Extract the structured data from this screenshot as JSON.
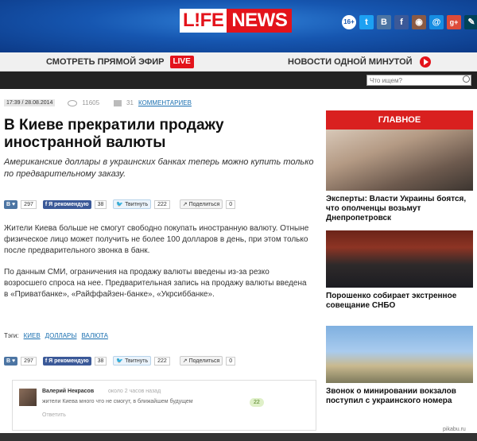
{
  "brand": {
    "life": "L!FE",
    "news": "NEWS",
    "age": "16+"
  },
  "social": [
    {
      "icon": "twitter-icon",
      "glyph": "t",
      "color": "#1da1f2"
    },
    {
      "icon": "vk-icon",
      "glyph": "В",
      "color": "#4c75a3"
    },
    {
      "icon": "facebook-icon",
      "glyph": "f",
      "color": "#3b5998"
    },
    {
      "icon": "instagram-icon",
      "glyph": "◉",
      "color": "#8a5a44"
    },
    {
      "icon": "mailru-icon",
      "glyph": "@",
      "color": "#168de2"
    },
    {
      "icon": "googleplus-icon",
      "glyph": "g+",
      "color": "#dd4b39"
    },
    {
      "icon": "livejournal-icon",
      "glyph": "✎",
      "color": "#004359"
    },
    {
      "icon": "odnoklassniki-icon",
      "glyph": "ok",
      "color": "#f2720c"
    }
  ],
  "nav": {
    "live_label": "СМОТРЕТЬ ПРЯМОЙ ЭФИР",
    "live_badge": "LIVE",
    "minute_label": "НОВОСТИ ОДНОЙ МИНУТОЙ"
  },
  "search": {
    "placeholder": "Что ищем?"
  },
  "article": {
    "date": "17:39 / 28.08.2014",
    "views": "11605",
    "comments_count": "31",
    "comments_label": "КОММЕНТАРИЕВ",
    "title": "В Киеве прекратили продажу иностранной валюты",
    "lead": "Американские доллары в украинских банках теперь можно купить только по предварительному заказу.",
    "paragraphs": [
      "Жители Киева больше не смогут свободно покупать иностранную валюту. Отныне физическое лицо может получить не более 100 долларов в день, при этом только после предварительного звонка в банк.",
      "По данным СМИ, ограничения на продажу валюты введены из-за резко возросшего спроса на нее. Предварительная запись на продажу валюты введена в «Приватбанке», «Райффайзен-банке», «Укрсиббанке»."
    ],
    "tags_label": "Тэги:",
    "tags": [
      "КИЕВ",
      "ДОЛЛАРЫ",
      "ВАЛЮТА"
    ]
  },
  "share": {
    "vk_label": "В",
    "vk_count": "297",
    "fb_label": "Я рекомендую",
    "fb_count": "38",
    "tw_label": "Твитнуть",
    "tw_count": "222",
    "share_label": "Поделиться",
    "share_count": "0"
  },
  "comment": {
    "author": "Валерий Некрасов",
    "time": "около 2 часов назад",
    "text": "жители Киева много что не смогут, в ближайшем будущем",
    "reply": "Ответить",
    "votes": "22"
  },
  "sidebar": {
    "heading": "ГЛАВНОЕ",
    "items": [
      {
        "caption": "Эксперты: Власти Украины боятся, что ополченцы возьмут Днепропетровск"
      },
      {
        "caption": "Порошенко собирает экстренное совещание СНБО"
      },
      {
        "caption": "Звонок о минировании вокзалов поступил с украинского номера"
      }
    ]
  },
  "watermark": "pikabu.ru"
}
